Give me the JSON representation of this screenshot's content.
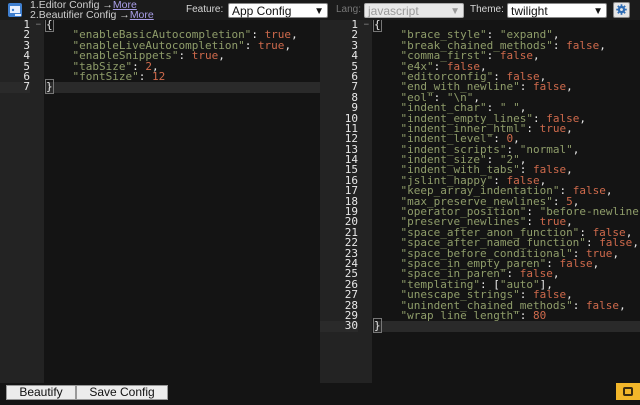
{
  "header": {
    "steps": [
      {
        "prefix": "1.Editor Config →",
        "link": "More"
      },
      {
        "prefix": "2.Beautifier Config →",
        "link": "More"
      }
    ],
    "feature_label": "Feature:",
    "feature_value": "App Config",
    "lang_label": "Lang:",
    "lang_value": "javascript",
    "theme_label": "Theme:",
    "theme_value": "twilight"
  },
  "left_editor": {
    "lines": [
      "{",
      "    \"enableBasicAutocompletion\": true,",
      "    \"enableLiveAutocompletion\": true,",
      "    \"enableSnippets\": true,",
      "    \"tabSize\": 2,",
      "    \"fontSize\": 12",
      "}"
    ]
  },
  "right_editor": {
    "lines": [
      "{",
      "    \"brace_style\": \"expand\",",
      "    \"break_chained_methods\": false,",
      "    \"comma_first\": false,",
      "    \"e4x\": false,",
      "    \"editorconfig\": false,",
      "    \"end_with_newline\": false,",
      "    \"eol\": \"\\n\",",
      "    \"indent_char\": \" \",",
      "    \"indent_empty_lines\": false,",
      "    \"indent_inner_html\": true,",
      "    \"indent_level\": 0,",
      "    \"indent_scripts\": \"normal\",",
      "    \"indent_size\": \"2\",",
      "    \"indent_with_tabs\": false,",
      "    \"jslint_happy\": false,",
      "    \"keep_array_indentation\": false,",
      "    \"max_preserve_newlines\": 5,",
      "    \"operator_position\": \"before-newline\",",
      "    \"preserve_newlines\": true,",
      "    \"space_after_anon_function\": false,",
      "    \"space_after_named_function\": false,",
      "    \"space_before_conditional\": true,",
      "    \"space_in_empty_paren\": false,",
      "    \"space_in_paren\": false,",
      "    \"templating\": [\"auto\"],",
      "    \"unescape_strings\": false,",
      "    \"unindent_chained_methods\": false,",
      "    \"wrap_line_length\": 80",
      "}"
    ]
  },
  "footer": {
    "beautify_label": "Beautify",
    "save_label": "Save Config"
  },
  "colors": {
    "background": "#141414",
    "gutter": "#232323",
    "string": "#8f9d6a",
    "number": "#cf6a4c",
    "link": "#a99ee8",
    "status": "#f2b62a"
  },
  "icons": [
    "app-icon",
    "chevron-down-icon",
    "gear-icon",
    "fold-arrow-icon",
    "status-icon"
  ]
}
